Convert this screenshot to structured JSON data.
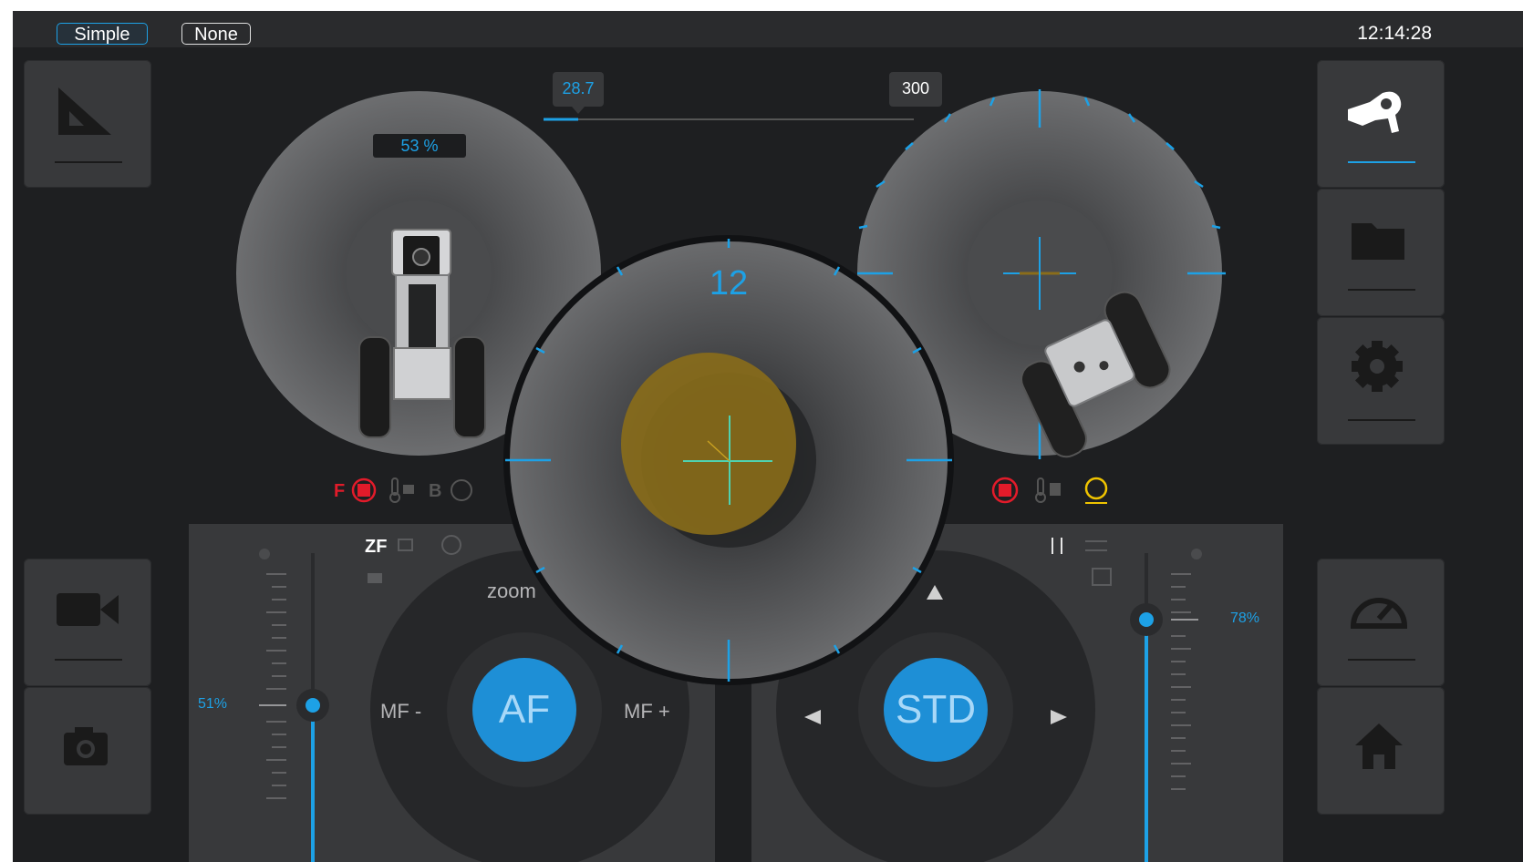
{
  "topbar": {
    "mode_simple": "Simple",
    "mode_none": "None",
    "clock": "12:14:28"
  },
  "slider_top": {
    "value_left": "28.7",
    "value_right": "300"
  },
  "left_gauge": {
    "percent": "53 %",
    "status_front": "F",
    "status_back": "B"
  },
  "center_gauge": {
    "clock_value": "12"
  },
  "left_controls": {
    "zf_label": "ZF",
    "zoom_label": "zoom",
    "mf_minus": "MF -",
    "af_label": "AF",
    "mf_plus": "MF +",
    "light_percent": "51%",
    "light_level": 0.51
  },
  "right_controls": {
    "std_label": "STD",
    "light_percent": "78%",
    "light_level": 0.78
  },
  "colors": {
    "accent": "#1da1e6",
    "alert": "#e21b2a",
    "warn": "#f0c400",
    "target": "#8a6d1a"
  },
  "icons": [
    "ruler-triangle-icon",
    "hand-pointer-icon",
    "folder-icon",
    "gear-icon",
    "video-camera-icon",
    "camera-icon",
    "speedometer-icon",
    "home-icon"
  ]
}
